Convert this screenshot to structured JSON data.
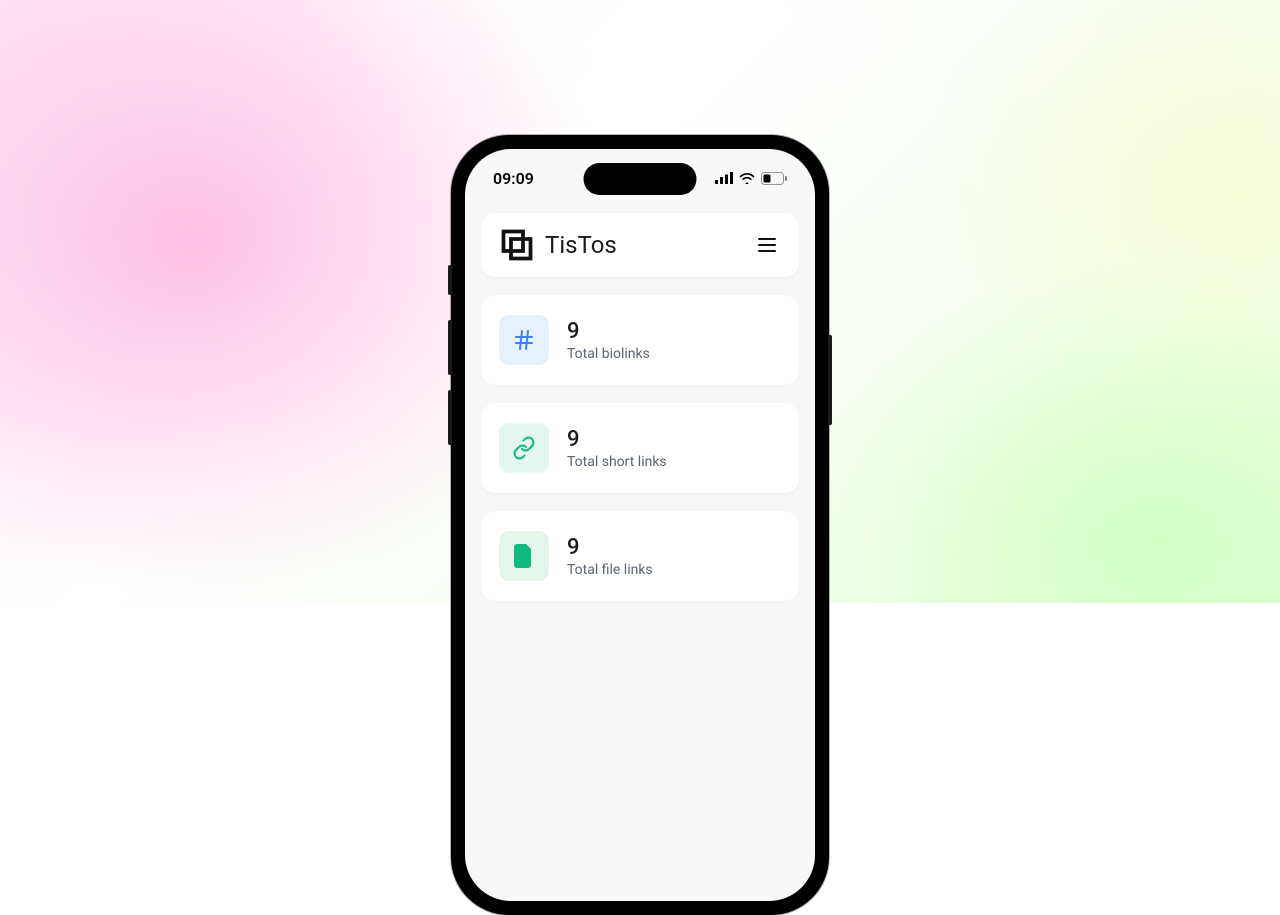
{
  "status": {
    "time": "09:09"
  },
  "header": {
    "brand": "TisTos"
  },
  "stats": {
    "biolinks": {
      "value": "9",
      "label": "Total biolinks"
    },
    "shortlinks": {
      "value": "9",
      "label": "Total short links"
    },
    "filelinks": {
      "value": "9",
      "label": "Total file links"
    }
  }
}
